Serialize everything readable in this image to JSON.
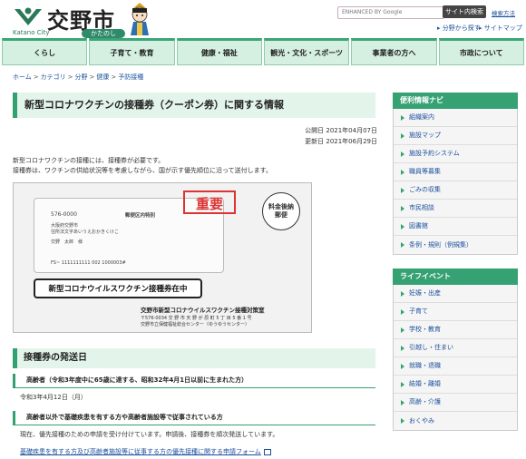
{
  "header": {
    "site_title": "交野市",
    "site_sub_en": "Katano City",
    "site_sub_jp": "かたのし",
    "search_placeholder": "ENHANCED BY Google",
    "search_button": "サイト内検索",
    "accessibility_link": "検索方法",
    "sub_links": [
      "分野から探す",
      "サイトマップ"
    ]
  },
  "nav": {
    "items": [
      "くらし",
      "子育て・教育",
      "健康・福祉",
      "観光・文化・スポーツ",
      "事業者の方へ",
      "市政について"
    ]
  },
  "breadcrumb": [
    "ホーム",
    "カテゴリ",
    "分野",
    "健康",
    "予防接種"
  ],
  "page": {
    "title": "新型コロナワクチンの接種券（クーポン券）に関する情報",
    "published": "公開日 2021年04月07日",
    "updated": "更新日 2021年06月29日",
    "intro_1": "新型コロナワクチンの接種には、接種券が必要です。",
    "intro_2": "接種券は、ワクチンの供給状況等を考慮しながら、国が示す優先順位に沿って送付します。"
  },
  "envelope": {
    "zip": "576-0000",
    "recipient_line1": "大阪府交野市",
    "recipient_line2": "住所法文字あいうえおかきくけこ",
    "recipient_name": "交野　太郎　様",
    "mail_class": "郵便区内特別",
    "barcode_line": "FS~      1111111111       002  1000003#",
    "urgent": "重要",
    "postage": "料金後納郵便",
    "banner": "新型コロナウイルスワクチン接種券在中",
    "sender": "交野市新型コロナウイルスワクチン接種対策室",
    "sender_addr1": "〒576-0034 交 野 市 天 野 が 原 町 5 丁 目 5 番 1 号",
    "sender_addr2": "交野市立保健福祉総合センター（ゆうゆうセンター）"
  },
  "section": {
    "heading": "接種券の発送日",
    "sub1": "高齢者（令和3年度中に65歳に達する、昭和32年4月1日以前に生まれた方）",
    "date": "令和3年4月12日（月）",
    "sub2": "高齢者以外で基礎疾患を有する方や高齢者施設等で従事されている方",
    "sub2_body": "現在、優先接種のための申請を受け付けています。申請後、接種券を順次発送しています。",
    "sub2_link": "基礎疾患を有する方及び高齢者施設等に従事する方の優先接種に関する申請フォーム"
  },
  "sidebar": {
    "nav_title": "便利情報ナビ",
    "nav_items": [
      "組織案内",
      "施設マップ",
      "施設予約システム",
      "職員等募集",
      "ごみの収集",
      "市民相談",
      "図書館",
      "条例・規則（例規集）"
    ],
    "life_title": "ライフイベント",
    "life_items": [
      "妊娠・出産",
      "子育て",
      "学校・教育",
      "引越し・住まい",
      "就職・退職",
      "結婚・離婚",
      "高齢・介護",
      "おくやみ"
    ]
  }
}
